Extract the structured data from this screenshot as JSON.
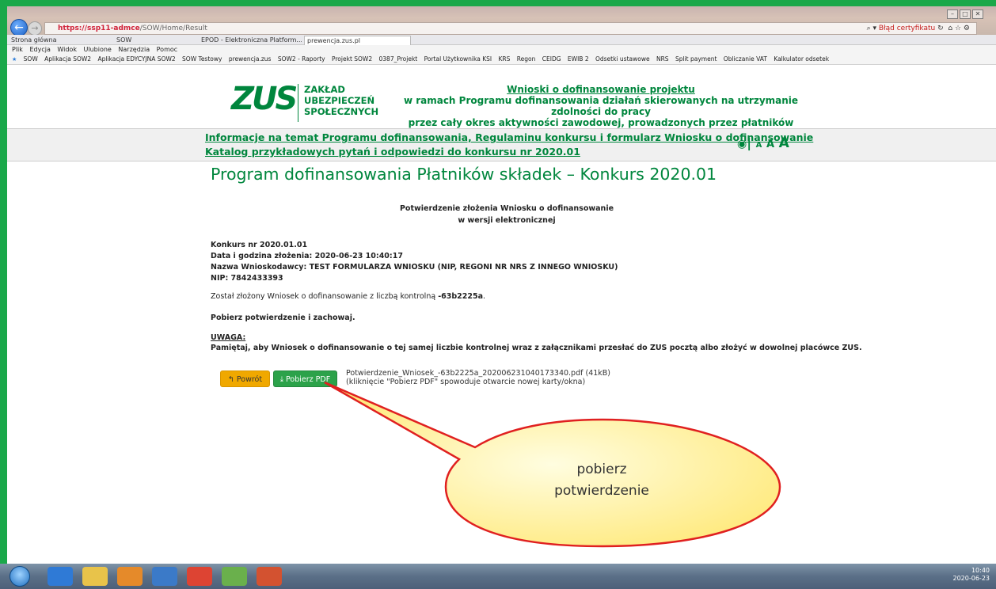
{
  "browser": {
    "url_host": "https://ssp11-admce",
    "url_path": "/SOW/Home/Result",
    "cert_error": "Błąd certyfikatu",
    "tabs": [
      "Strona główna",
      "SOW",
      "EPOD - Elektroniczna Platform...",
      "prewencja.zus.pl"
    ],
    "menu": [
      "Plik",
      "Edycja",
      "Widok",
      "Ulubione",
      "Narzędzia",
      "Pomoc"
    ],
    "favorites": [
      "SOW",
      "Aplikacja SOW2",
      "Aplikacja EDYCYJNA SOW2",
      "SOW Testowy",
      "prewencja.zus",
      "SOW2 - Raporty",
      "Projekt SOW2",
      "0387_Projekt",
      "Portal Użytkownika KSI",
      "KRS",
      "Regon",
      "CEIDG",
      "EWIB 2",
      "Odsetki ustawowe",
      "NRS",
      "Split payment",
      "Obliczanie VAT",
      "Kalkulator odsetek"
    ]
  },
  "header": {
    "logo": "ZUS",
    "institution": [
      "ZAKŁAD",
      "UBEZPIECZEŃ",
      "SPOŁECZNYCH"
    ],
    "title_link": "Wnioski o dofinansowanie projektu",
    "title_line2": "w ramach Programu dofinansowania działań skierowanych na utrzymanie zdolności do pracy",
    "title_line3": "przez cały okres aktywności zawodowej, prowadzonych przez płatników składek"
  },
  "infobar": {
    "link1": "Informacje na temat Programu dofinansowania, Regulaminu konkursu i formularz Wniosku o dofinansowanie",
    "link2": "Katalog przykładowych pytań i odpowiedzi do konkursu nr 2020.01",
    "a_small": "A",
    "a_medium": "A",
    "a_large": "A"
  },
  "page": {
    "title": "Program dofinansowania Płatników składek – Konkurs 2020.01",
    "confirm_line1": "Potwierdzenie złożenia Wniosku o dofinansowanie",
    "confirm_line2": "w wersji elektronicznej",
    "contest": "Konkurs nr 2020.01.01",
    "datetime": "Data i godzina złożenia: 2020-06-23 10:40:17",
    "applicant": "Nazwa Wnioskodawcy: TEST FORMULARZA WNIOSKU (NIP, REGONI NR NRS Z INNEGO WNIOSKU)",
    "nip": "NIP: 7842433393",
    "submitted_prefix": "Został złożony Wniosek o dofinansowanie z liczbą kontrolną ",
    "control_number": "-63b2225a",
    "submitted_suffix": ".",
    "download_hint": "Pobierz potwierdzenie i zachowaj.",
    "warning_title": "UWAGA:",
    "warning_text": "Pamiętaj, aby Wniosek o dofinansowanie o tej samej liczbie kontrolnej wraz z załącznikami przesłać do ZUS pocztą albo złożyć w dowolnej placówce ZUS.",
    "btn_back": "Powrót",
    "btn_pdf": "Pobierz PDF",
    "file_name": "Potwierdzenie_Wniosek_-63b2225a_20200623104017334​0.pdf (41kB)",
    "file_note": "(kliknięcie \"Pobierz PDF\" spowoduje otwarcie nowej karty/okna)"
  },
  "callout": {
    "line1": "pobierz",
    "line2": "potwierdzenie"
  },
  "taskbar": {
    "time": "10:40",
    "date": "2020-06-23"
  },
  "colors": {
    "frame": "#1aa84a",
    "zus_green": "#00863d",
    "back_button": "#f0a800",
    "pdf_button": "#2ca24a",
    "callout_fill": "#fff8b0",
    "callout_stroke": "#e02020"
  }
}
